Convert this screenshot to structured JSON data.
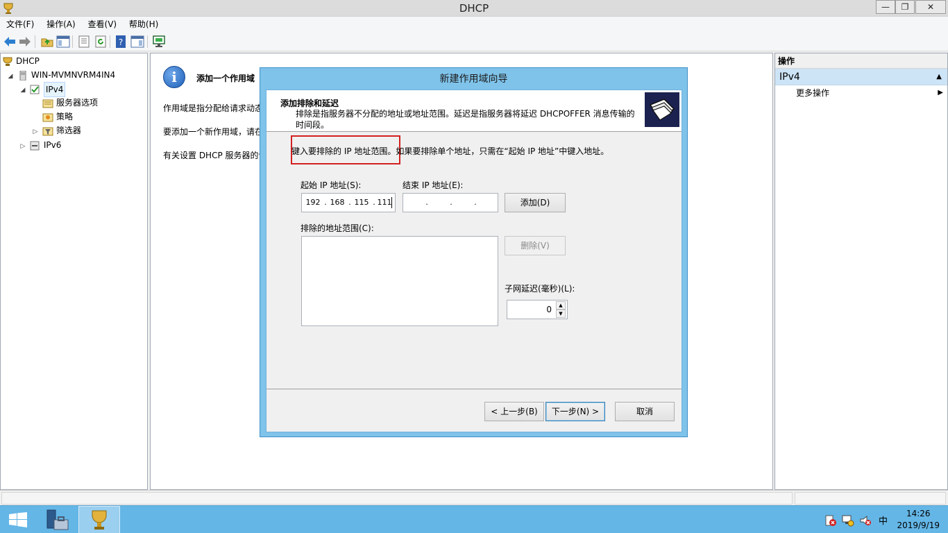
{
  "window": {
    "title": "DHCP",
    "minimize": "—",
    "restore": "❐",
    "close": "✕"
  },
  "menu": {
    "items": [
      "文件(F)",
      "操作(A)",
      "查看(V)",
      "帮助(H)"
    ]
  },
  "tree": {
    "root": "DHCP",
    "server": "WIN-MVMNVRM4IN4",
    "ipv4": "IPv4",
    "server_options": "服务器选项",
    "policies": "策略",
    "filters": "筛选器",
    "ipv6": "IPv6"
  },
  "center": {
    "title": "添加一个作用域",
    "line1": "作用域是指分配给请求动态",
    "line2": "要添加一个新作用域，请在",
    "line3": "有关设置 DHCP 服务器的详"
  },
  "actions": {
    "header": "操作",
    "section": "IPv4",
    "more": "更多操作"
  },
  "wizard": {
    "title": "新建作用域向导",
    "header_title": "添加排除和延迟",
    "header_desc": "排除是指服务器不分配的地址或地址范围。延迟是指服务器将延迟 DHCPOFFER 消息传输的时间段。",
    "instruction_highlight": "键入要排除的 IP 地址范围。",
    "instruction_rest": "如果要排除单个地址，只需在“起始 IP 地址”中键入地址。",
    "start_ip_label": "起始 IP 地址(S):",
    "end_ip_label": "结束 IP 地址(E):",
    "start_ip": [
      "192",
      "168",
      "115",
      "111"
    ],
    "end_ip": [
      "",
      "",
      "",
      ""
    ],
    "add_button": "添加(D)",
    "excluded_label": "排除的地址范围(C):",
    "remove_button": "删除(V)",
    "delay_label": "子网延迟(毫秒)(L):",
    "delay_value": "0",
    "back_button": "< 上一步(B)",
    "next_button": "下一步(N) >",
    "cancel_button": "取消"
  },
  "taskbar": {
    "tray_lang": "中",
    "time": "14:26",
    "date": "2019/9/19"
  },
  "colors": {
    "taskbar": "#64b6e6",
    "dialog_frame": "#7fc3ea",
    "highlight_box": "#d32020",
    "actions_section": "#cde4f7"
  }
}
